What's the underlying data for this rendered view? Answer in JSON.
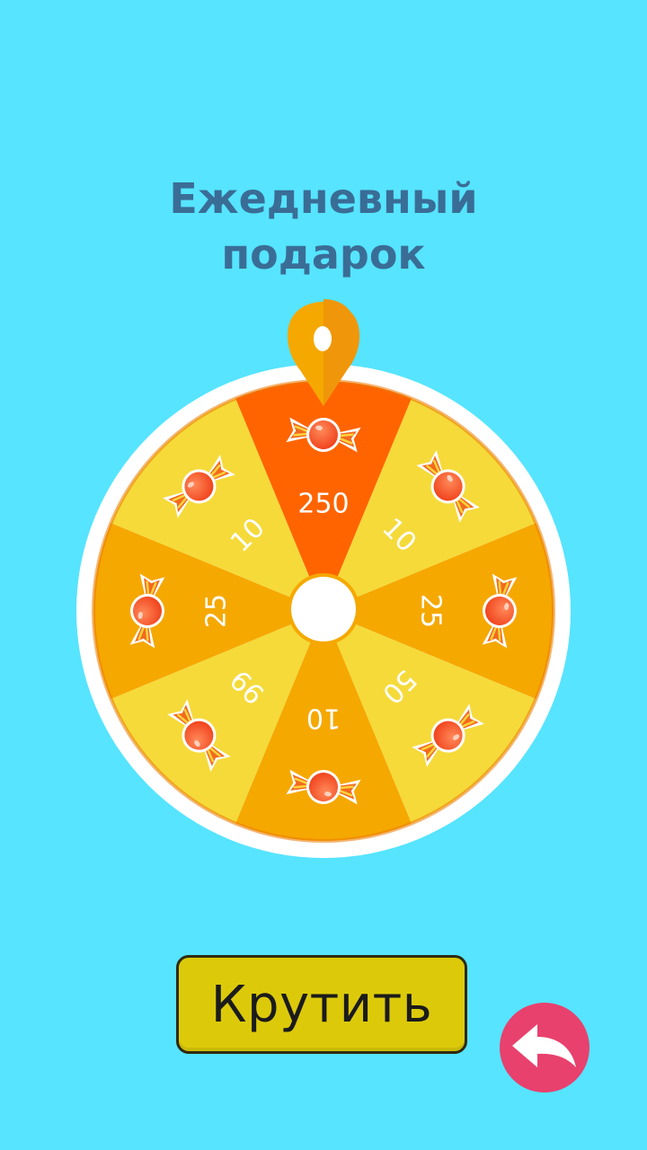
{
  "title": {
    "line1": "Ежедневный",
    "line2": "подарок"
  },
  "wheel": {
    "pointer_icon": "map-pin-icon",
    "segments": [
      {
        "value": "250",
        "icon": "candy-icon",
        "color": "#ff6400"
      },
      {
        "value": "10",
        "icon": "candy-icon",
        "color": "#f5da3a"
      },
      {
        "value": "25",
        "icon": "candy-icon",
        "color": "#f5a800"
      },
      {
        "value": "50",
        "icon": "candy-icon",
        "color": "#f5da3a"
      },
      {
        "value": "10",
        "icon": "candy-icon",
        "color": "#f5a800"
      },
      {
        "value": "99",
        "icon": "candy-icon",
        "color": "#f5da3a"
      },
      {
        "value": "25",
        "icon": "candy-icon",
        "color": "#f5a800"
      },
      {
        "value": "10",
        "icon": "candy-icon",
        "color": "#f5da3a"
      }
    ]
  },
  "spin_button": {
    "label": "Крутить"
  },
  "back_button": {
    "icon": "back-arrow-icon"
  },
  "colors": {
    "background": "#56e4ff",
    "title": "#3a6d96",
    "spin_button": "#dcca0a",
    "back_button": "#e8416e",
    "pointer": "#f5a800"
  }
}
